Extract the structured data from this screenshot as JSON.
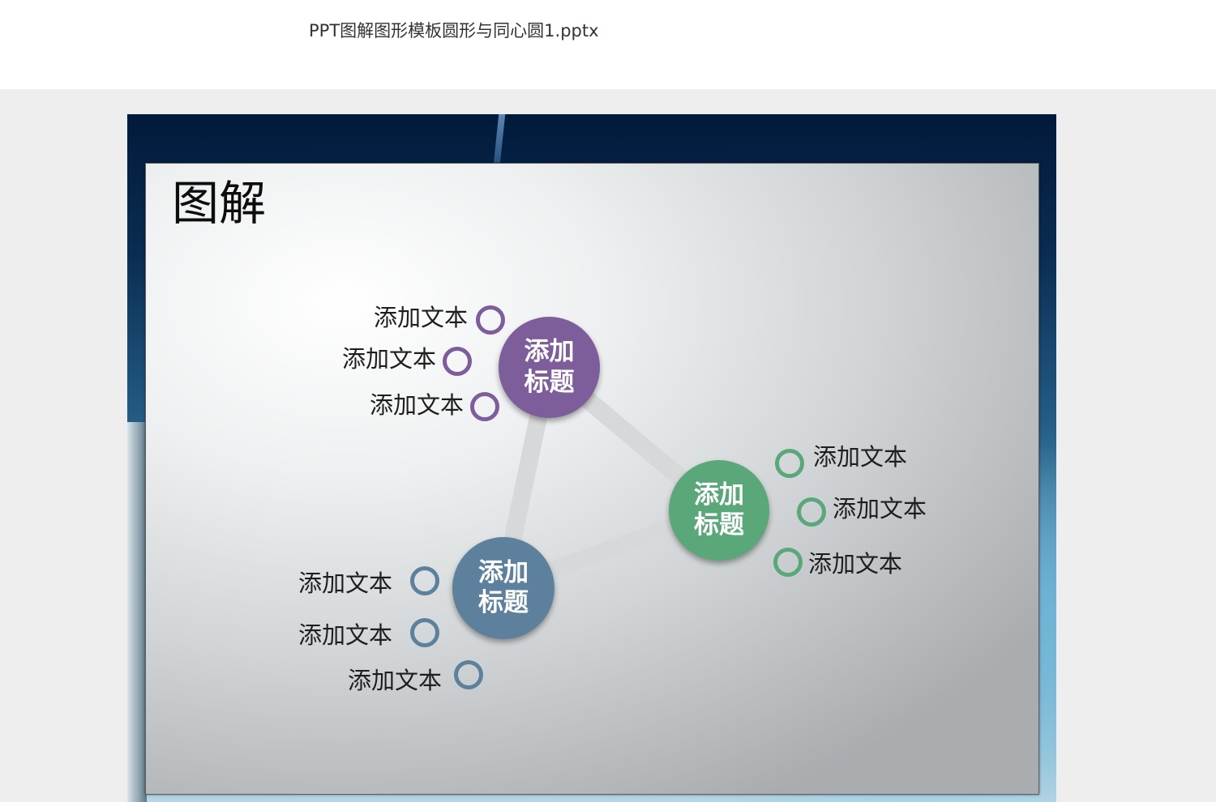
{
  "document": {
    "title": "PPT图解图形模板圆形与同心圆1.pptx"
  },
  "slide": {
    "heading": "图解",
    "colors": {
      "purple": "#7d5e9a",
      "green": "#5aa77a",
      "blue": "#5d819d",
      "connector": "#d6d8d9"
    },
    "hubs": [
      {
        "id": "purple",
        "line1": "添加",
        "line2": "标题",
        "items": [
          "添加文本",
          "添加文本",
          "添加文本"
        ]
      },
      {
        "id": "green",
        "line1": "添加",
        "line2": "标题",
        "items": [
          "添加文本",
          "添加文本",
          "添加文本"
        ]
      },
      {
        "id": "blue",
        "line1": "添加",
        "line2": "标题",
        "items": [
          "添加文本",
          "添加文本",
          "添加文本"
        ]
      }
    ]
  }
}
